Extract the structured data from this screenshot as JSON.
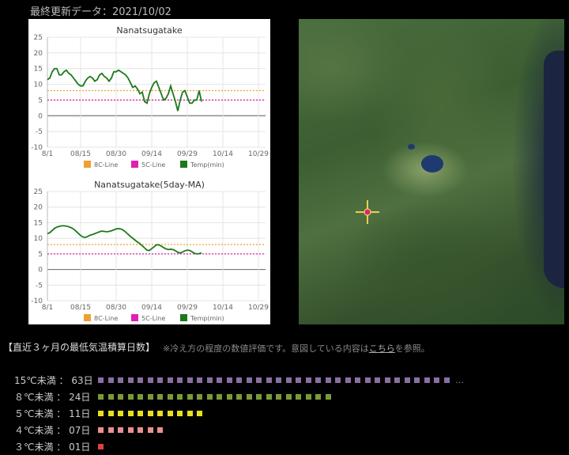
{
  "header": {
    "updated_label": "最終更新データ：2021/10/02"
  },
  "charts": [
    {
      "title": "Nanatsugatake",
      "legend": [
        {
          "name": "8C-Line",
          "color": "#f0a030"
        },
        {
          "name": "5C-Line",
          "color": "#e020b0"
        },
        {
          "name": "Temp(min)",
          "color": "#1a7a1a"
        }
      ]
    },
    {
      "title": "Nanatsugatake(5day-MA)",
      "legend": [
        {
          "name": "8C-Line",
          "color": "#f0a030"
        },
        {
          "name": "5C-Line",
          "color": "#e020b0"
        },
        {
          "name": "Temp(min)",
          "color": "#1a7a1a"
        }
      ]
    }
  ],
  "chart_data": [
    {
      "type": "line",
      "title": "Nanatsugatake",
      "x_tick_labels": [
        "8/1",
        "08/15",
        "08/30",
        "09/14",
        "09/29",
        "10/14",
        "10/29"
      ],
      "x_tick_days": [
        0,
        14,
        29,
        44,
        59,
        74,
        89
      ],
      "xlim": [
        0,
        92
      ],
      "ylim": [
        -10,
        25
      ],
      "yticks": [
        -10,
        -5,
        0,
        5,
        10,
        15,
        20,
        25
      ],
      "grid": true,
      "legend_position": "bottom",
      "reference_lines": [
        {
          "name": "8C-Line",
          "value": 8,
          "color": "#f0a030"
        },
        {
          "name": "5C-Line",
          "value": 5,
          "color": "#e020b0"
        }
      ],
      "series": [
        {
          "name": "Temp(min)",
          "color": "#1a7a1a",
          "values": [
            11.5,
            12,
            14,
            15,
            15,
            13,
            13,
            14,
            14.5,
            13.5,
            13,
            12,
            11,
            10,
            9.5,
            9.5,
            11,
            12,
            12.5,
            12,
            11,
            11.5,
            13,
            13.5,
            12.5,
            12,
            11,
            12,
            14,
            14,
            14.5,
            14,
            13.5,
            13,
            12,
            10.5,
            9,
            9.5,
            8.5,
            7,
            7.5,
            4.5,
            4,
            7,
            9,
            10.5,
            11,
            9,
            7,
            5,
            5.5,
            7,
            9.5,
            7,
            4.5,
            1.5,
            5,
            7.5,
            8,
            6,
            4,
            4,
            5,
            5,
            8,
            4.5
          ]
        }
      ]
    },
    {
      "type": "line",
      "title": "Nanatsugatake(5day-MA)",
      "x_tick_labels": [
        "8/1",
        "08/15",
        "08/30",
        "09/14",
        "09/29",
        "10/14",
        "10/29"
      ],
      "x_tick_days": [
        0,
        14,
        29,
        44,
        59,
        74,
        89
      ],
      "xlim": [
        0,
        92
      ],
      "ylim": [
        -10,
        25
      ],
      "yticks": [
        -10,
        -5,
        0,
        5,
        10,
        15,
        20,
        25
      ],
      "grid": true,
      "legend_position": "bottom",
      "reference_lines": [
        {
          "name": "8C-Line",
          "value": 8,
          "color": "#f0a030"
        },
        {
          "name": "5C-Line",
          "value": 5,
          "color": "#e020b0"
        }
      ],
      "series": [
        {
          "name": "Temp(min)",
          "color": "#1a7a1a",
          "values": [
            11.5,
            11.8,
            12.5,
            13.2,
            13.6,
            13.8,
            14,
            14,
            13.9,
            13.7,
            13.4,
            13,
            12.3,
            11.6,
            10.9,
            10.4,
            10.3,
            10.6,
            11,
            11.2,
            11.5,
            11.8,
            12.1,
            12.3,
            12.2,
            12.1,
            12.2,
            12.4,
            12.7,
            13,
            13.1,
            13,
            12.6,
            12,
            11.3,
            10.6,
            10,
            9.4,
            8.8,
            8.3,
            7.6,
            6.9,
            6.2,
            6.1,
            6.7,
            7.3,
            7.9,
            7.9,
            7.5,
            7,
            6.6,
            6.4,
            6.5,
            6.4,
            6,
            5.5,
            5.3,
            5.6,
            6,
            6.2,
            6.1,
            5.7,
            5.2,
            5,
            5.1,
            5.3
          ]
        }
      ]
    }
  ],
  "summary": {
    "title": "【直近３ヶ月の最低気温積算日数】",
    "note_prefix": "※冷え方の程度の数値評価です。意図している内容は",
    "note_link": "こちら",
    "note_suffix": "を参照。",
    "rows": [
      {
        "label": "15℃未満 ： 63日",
        "days": 63,
        "color": "#8a6fa0",
        "squares_shown": 36,
        "overflow": "…"
      },
      {
        "label": "８℃未満 ： 24日",
        "days": 24,
        "color": "#7a9a3a",
        "squares_shown": 24
      },
      {
        "label": "５℃未満 ： 11日",
        "days": 11,
        "color": "#e8e020",
        "squares_shown": 11
      },
      {
        "label": "４℃未満 ： 07日",
        "days": 7,
        "color": "#e89090",
        "squares_shown": 7
      },
      {
        "label": "３℃未満 ： 01日",
        "days": 1,
        "color": "#e04040",
        "squares_shown": 1
      }
    ]
  }
}
